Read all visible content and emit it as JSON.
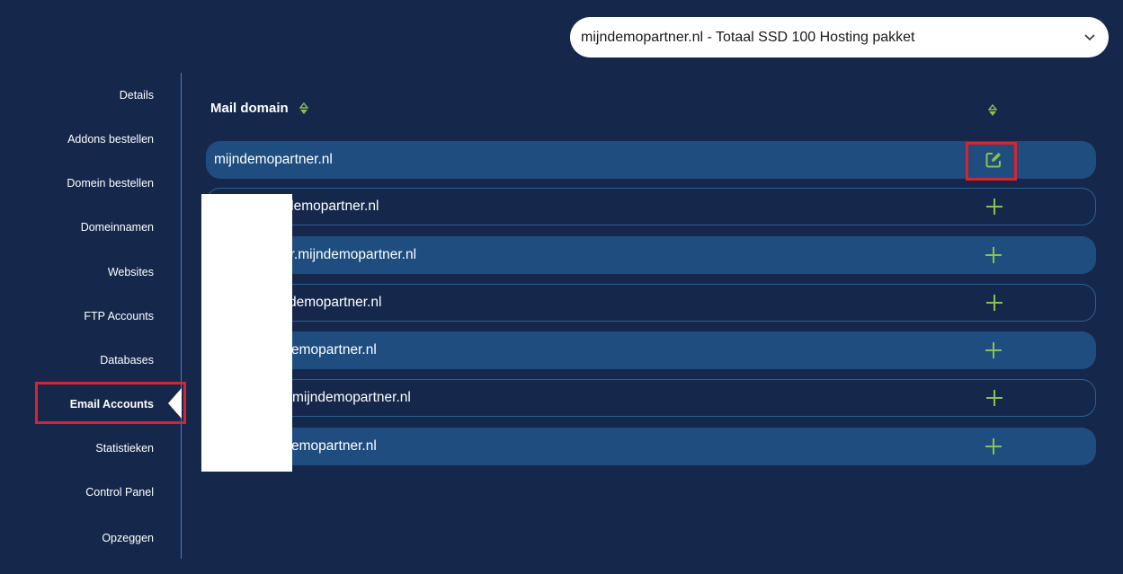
{
  "package_selector": {
    "value": "mijndemopartner.nl - Totaal SSD 100 Hosting pakket",
    "icon": "chevron-down-icon"
  },
  "sidebar": {
    "items": [
      {
        "label": "Details",
        "active": false
      },
      {
        "label": "Addons bestellen",
        "active": false
      },
      {
        "label": "Domein bestellen",
        "active": false
      },
      {
        "label": "Domeinnamen",
        "active": false
      },
      {
        "label": "Websites",
        "active": false
      },
      {
        "label": "FTP Accounts",
        "active": false
      },
      {
        "label": "Databases",
        "active": false
      },
      {
        "label": "Email Accounts",
        "active": true
      },
      {
        "label": "Statistieken",
        "active": false
      },
      {
        "label": "Control Panel",
        "active": false
      },
      {
        "label": "Opzeggen",
        "active": false
      }
    ]
  },
  "table": {
    "header": {
      "mail_domain": "Mail domain",
      "sort_icon": "sort-icon"
    },
    "rows": [
      {
        "domain": "mijndemopartner.nl",
        "action": "edit-icon"
      },
      {
        "domain": "demopartner.nl",
        "action": "plus-icon"
      },
      {
        "domain": "er.mijndemopartner.nl",
        "action": "plus-icon"
      },
      {
        "domain": "demopartner.nl",
        "action": "plus-icon"
      },
      {
        "domain": "emopartner.nl",
        "action": "plus-icon"
      },
      {
        "domain": "mijndemopartner.nl",
        "action": "plus-icon"
      },
      {
        "domain": "emopartner.nl",
        "action": "plus-icon"
      }
    ]
  },
  "colors": {
    "background": "#15284b",
    "row_fill": "#1f4d7f",
    "accent_green": "#8bc34a",
    "highlight_red": "#d9232e"
  }
}
